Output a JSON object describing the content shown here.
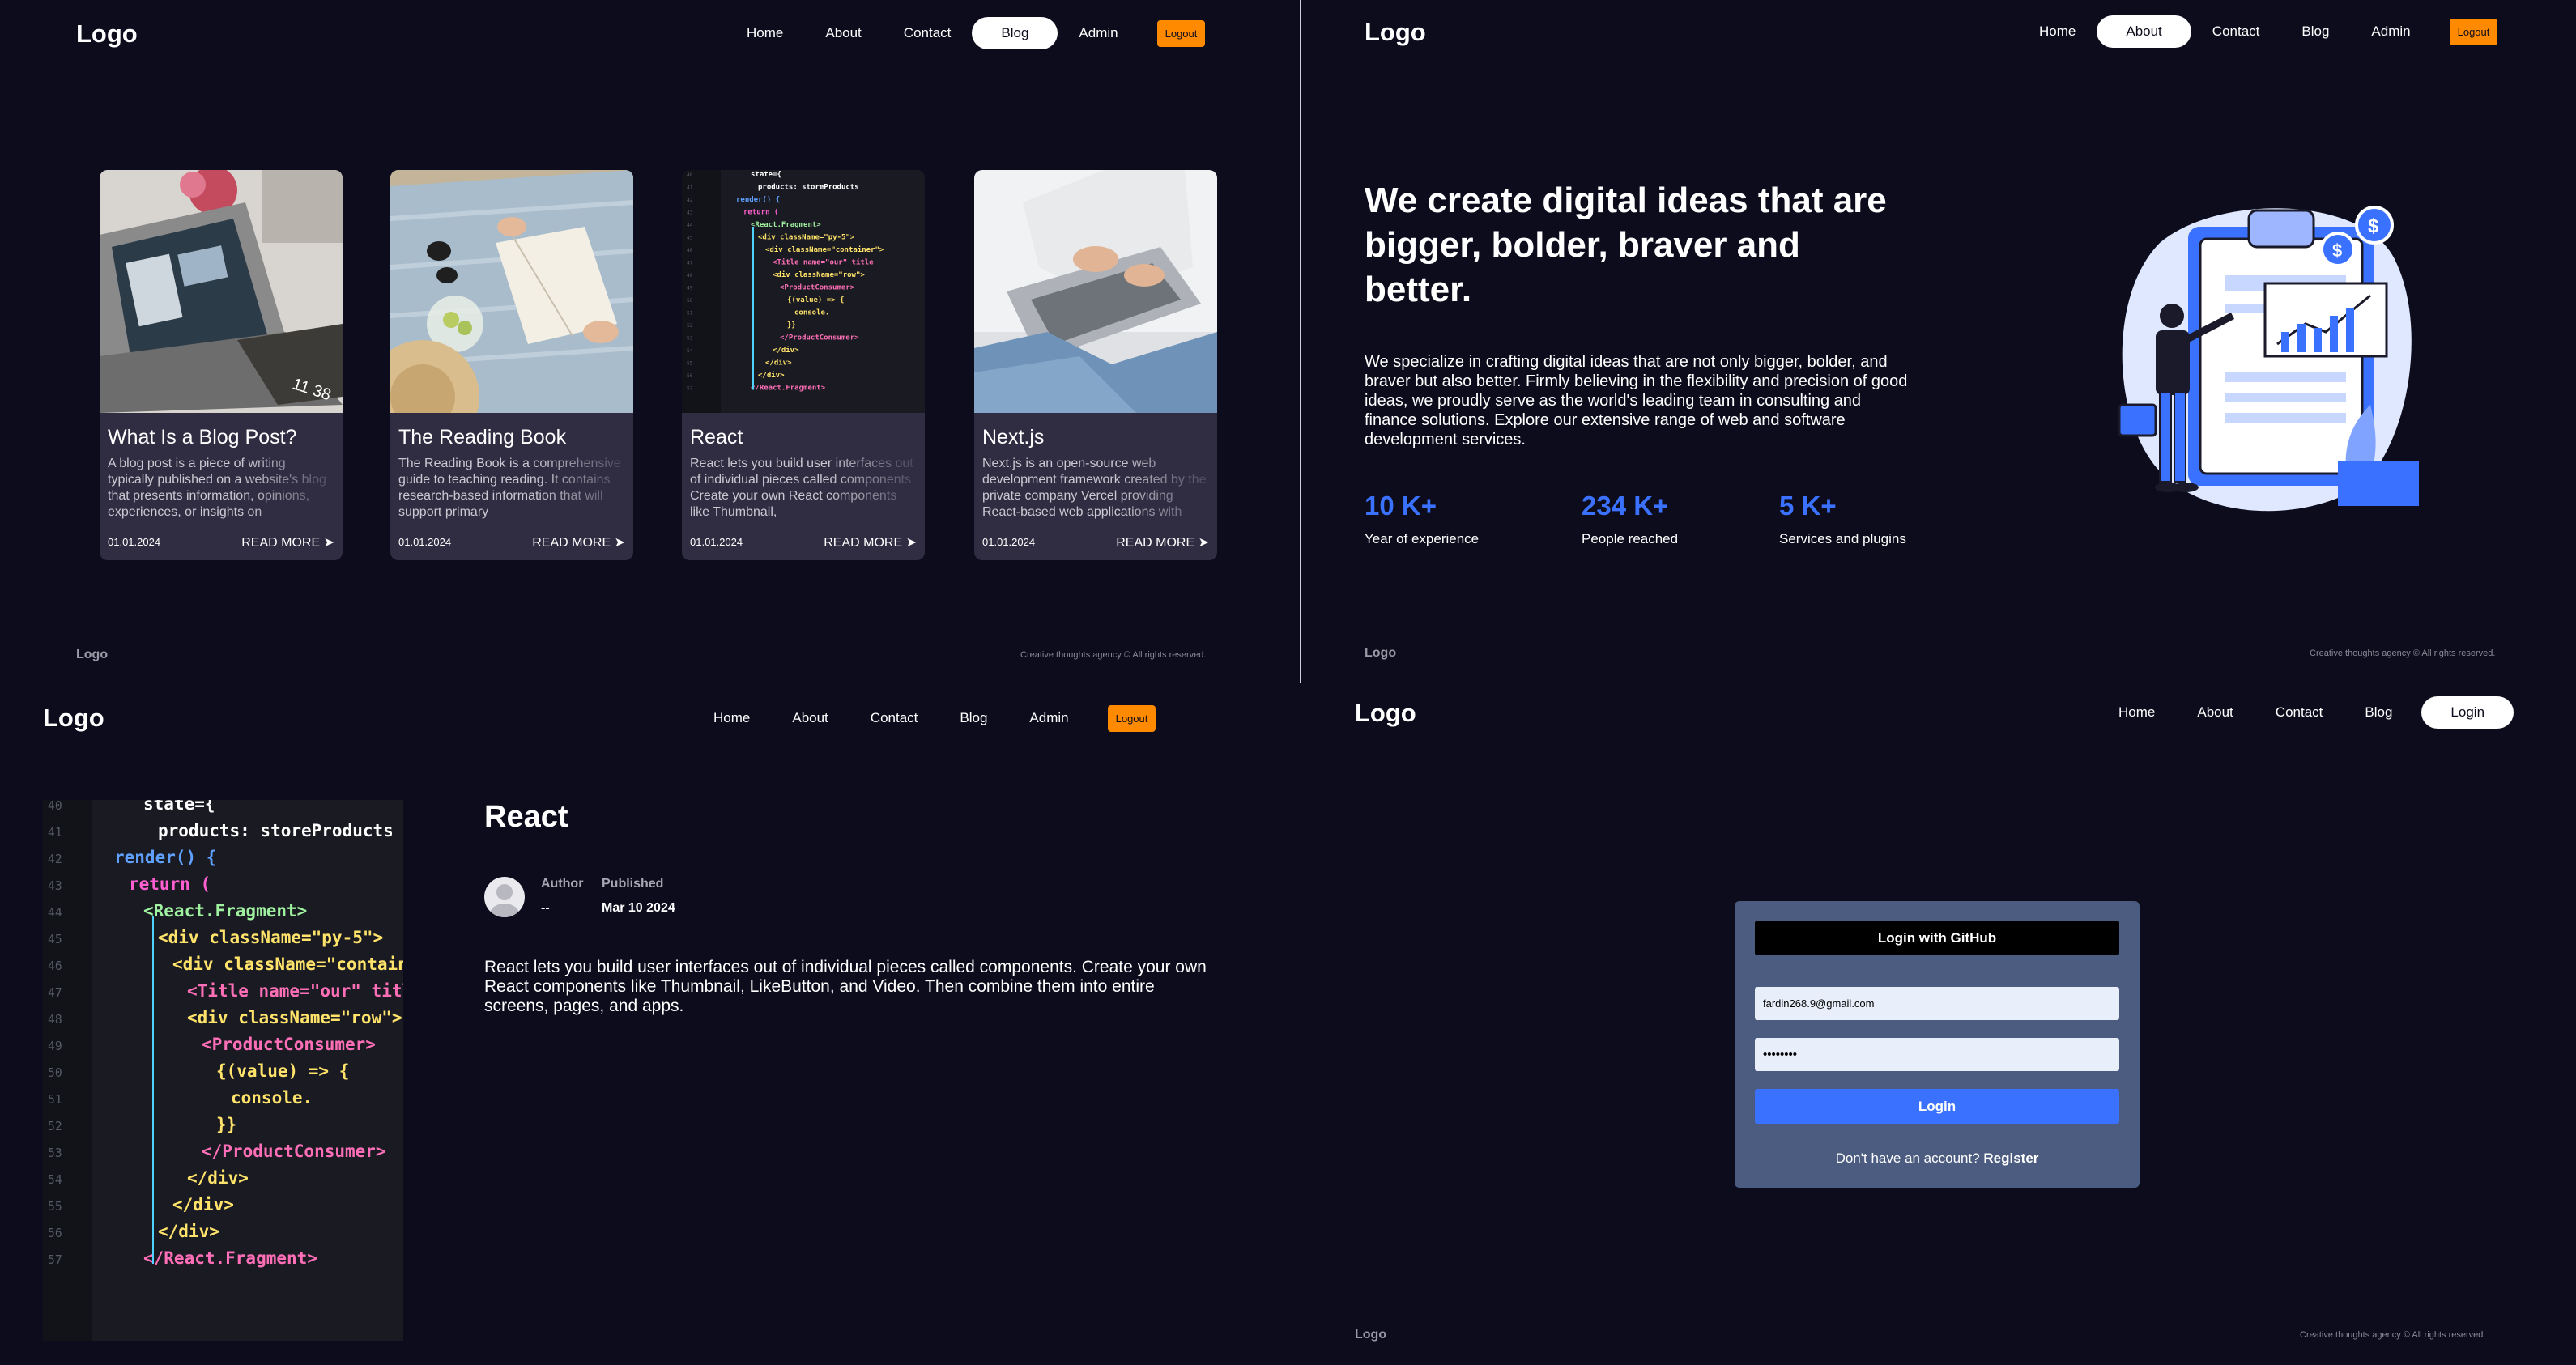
{
  "nav": {
    "logo": "Logo",
    "home": "Home",
    "about": "About",
    "contact": "Contact",
    "blog": "Blog",
    "admin": "Admin",
    "logout": "Logout",
    "login": "Login"
  },
  "footer": {
    "logo": "Logo",
    "text": "Creative thoughts agency © All rights reserved."
  },
  "blog": {
    "read_more": "READ MORE ➤",
    "cards": [
      {
        "title": "What Is a Blog Post?",
        "desc": "A blog post is a piece of writing typically published on a website's blog that presents information, opinions, experiences, or insights on",
        "date": "01.01.2024"
      },
      {
        "title": "The Reading Book",
        "desc": "The Reading Book is a comprehensive guide to teaching reading. It contains research-based information that will support primary",
        "date": "01.01.2024"
      },
      {
        "title": "React",
        "desc": "React lets you build user interfaces out of individual pieces called components. Create your own React components like Thumbnail,",
        "date": "01.01.2024"
      },
      {
        "title": "Next.js",
        "desc": "Next.js is an open-source web development framework created by the private company Vercel providing React-based web applications with",
        "date": "01.01.2024"
      }
    ]
  },
  "about": {
    "heading": "We create digital ideas that are bigger, bolder, braver and better.",
    "description": "We specialize in crafting digital ideas that are not only bigger, bolder, and braver but also better. Firmly believing in the flexibility and precision of good ideas, we proudly serve as the world's leading team in consulting and finance solutions. Explore our extensive range of web and software development services.",
    "stats": [
      {
        "value": "10 K+",
        "label": "Year of experience"
      },
      {
        "value": "234 K+",
        "label": "People reached"
      },
      {
        "value": "5 K+",
        "label": "Services and plugins"
      }
    ]
  },
  "post": {
    "title": "React",
    "author_label": "Author",
    "author_value": "--",
    "published_label": "Published",
    "published_value": "Mar 10 2024",
    "body": "React lets you build user interfaces out of individual pieces called components. Create your own React components like Thumbnail, LikeButton, and Video. Then combine them into entire screens, pages, and apps."
  },
  "code_lines": [
    "state={",
    "products: storeProducts",
    "render() {",
    "return (",
    "<React.Fragment>",
    "<div className=\"py-5\">",
    "<div className=\"container\">",
    "<Title name=\"our\" title",
    "<div className=\"row\">",
    "<ProductConsumer>",
    "{(value) => {",
    "console.",
    "}}",
    "</ProductConsumer>",
    "</div>",
    "</div>",
    "</div>",
    "</React.Fragment>"
  ],
  "login": {
    "github_button": "Login with GitHub",
    "email_value": "fardin268.9@gmail.com",
    "password_value": "••••••••",
    "login_button": "Login",
    "register_prompt": "Don't have an account?",
    "register_link": "Register"
  },
  "colors": {
    "background": "#0d0c1d",
    "card": "#302d42",
    "accent_blue": "#3a72ff",
    "logout_orange": "#ff8a00",
    "login_panel": "#4b5c80"
  }
}
